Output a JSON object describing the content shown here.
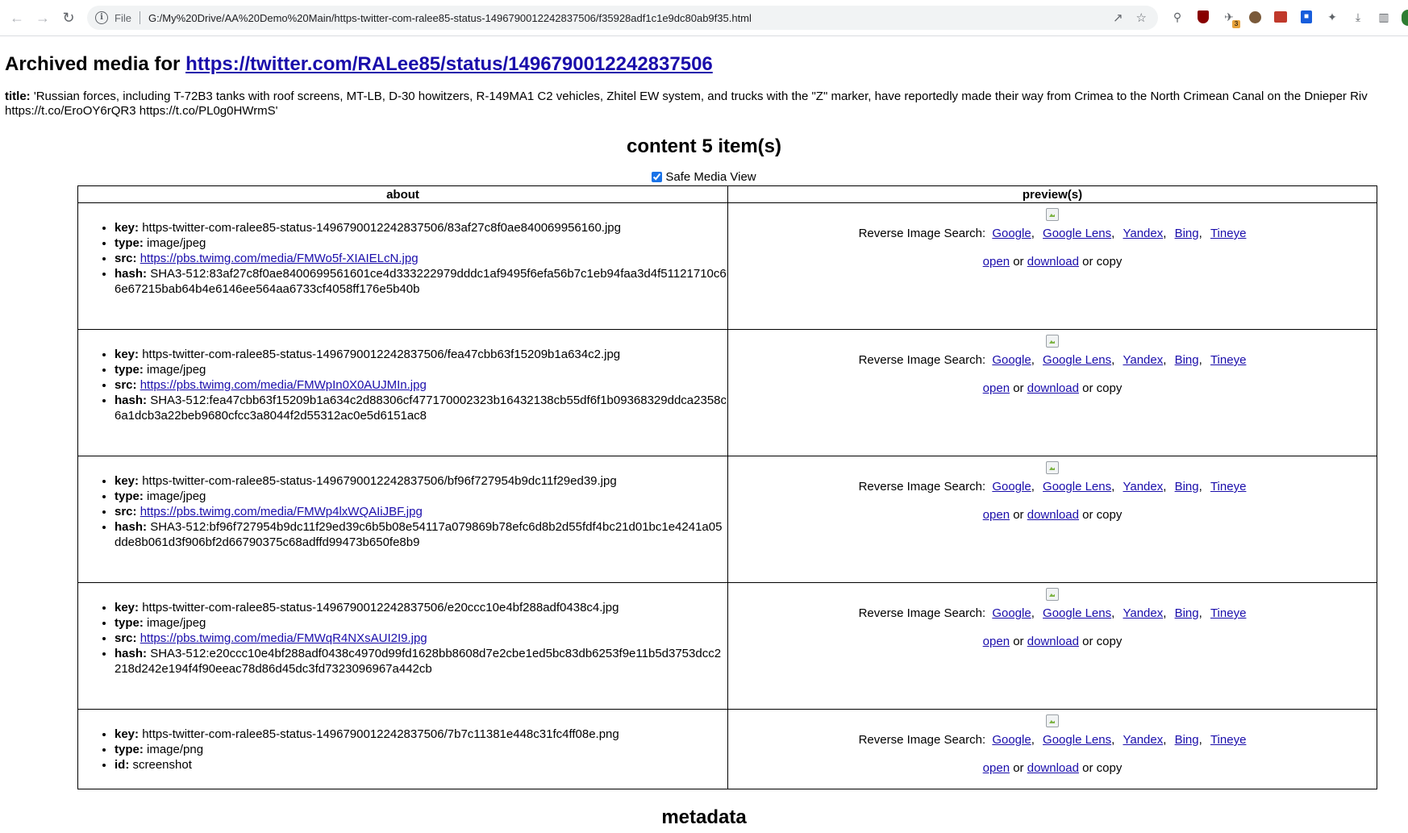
{
  "browser": {
    "scheme": "File",
    "url": "G:/My%20Drive/AA%20Demo%20Main/https-twitter-com-ralee85-status-1496790012242837506/f35928adf1c1e9dc80ab9f35.html",
    "extension_badge": "3"
  },
  "page": {
    "heading_prefix": "Archived media for",
    "heading_link": "https://twitter.com/RALee85/status/1496790012242837506",
    "title_label": "title:",
    "title_text": "'Russian forces, including T-72B3 tanks with roof screens, MT-LB, D-30 howitzers, R-149MA1 C2 vehicles, Zhitel EW system, and trucks with the \"Z\" marker, have reportedly made their way from Crimea to the North Crimean Canal on the Dnieper Riv",
    "title_text_line2": "https://t.co/EroOY6rQR3 https://t.co/PL0g0HWrmS'",
    "content_heading": "content 5 item(s)",
    "safe_media_label": "Safe Media View",
    "col_about": "about",
    "col_preview": "preview(s)",
    "metadata_heading": "metadata"
  },
  "labels": {
    "key": "key:",
    "type": "type:",
    "src": "src:",
    "hash": "hash:",
    "id": "id:",
    "reverse_search": "Reverse Image Search:",
    "google": "Google",
    "google_lens": "Google Lens",
    "yandex": "Yandex",
    "bing": "Bing",
    "tineye": "Tineye",
    "open": "open",
    "or1": "or",
    "download": "download",
    "or_copy": "or copy"
  },
  "items": [
    {
      "key": "https-twitter-com-ralee85-status-1496790012242837506/83af27c8f0ae840069956160.jpg",
      "type": "image/jpeg",
      "src": "https://pbs.twimg.com/media/FMWo5f-XIAIELcN.jpg",
      "hash": "SHA3-512:83af27c8f0ae8400699561601ce4d333222979dddc1af9495f6efa56b7c1eb94faa3d4f51121710c66e67215bab64b4e6146ee564aa6733cf4058ff176e5b40b"
    },
    {
      "key": "https-twitter-com-ralee85-status-1496790012242837506/fea47cbb63f15209b1a634c2.jpg",
      "type": "image/jpeg",
      "src": "https://pbs.twimg.com/media/FMWpIn0X0AUJMIn.jpg",
      "hash": "SHA3-512:fea47cbb63f15209b1a634c2d88306cf477170002323b16432138cb55df6f1b09368329ddca2358c6a1dcb3a22beb9680cfcc3a8044f2d55312ac0e5d6151ac8"
    },
    {
      "key": "https-twitter-com-ralee85-status-1496790012242837506/bf96f727954b9dc11f29ed39.jpg",
      "type": "image/jpeg",
      "src": "https://pbs.twimg.com/media/FMWp4lxWQAIiJBF.jpg",
      "hash": "SHA3-512:bf96f727954b9dc11f29ed39c6b5b08e54117a079869b78efc6d8b2d55fdf4bc21d01bc1e4241a05dde8b061d3f906bf2d66790375c68adffd99473b650fe8b9"
    },
    {
      "key": "https-twitter-com-ralee85-status-1496790012242837506/e20ccc10e4bf288adf0438c4.jpg",
      "type": "image/jpeg",
      "src": "https://pbs.twimg.com/media/FMWqR4NXsAUI2I9.jpg",
      "hash": "SHA3-512:e20ccc10e4bf288adf0438c4970d99fd1628bb8608d7e2cbe1ed5bc83db6253f9e11b5d3753dcc2218d242e194f4f90eeac78d86d45dc3fd7323096967a442cb"
    },
    {
      "key": "https-twitter-com-ralee85-status-1496790012242837506/7b7c11381e448c31fc4ff08e.png",
      "type": "image/png",
      "id": "screenshot"
    }
  ]
}
